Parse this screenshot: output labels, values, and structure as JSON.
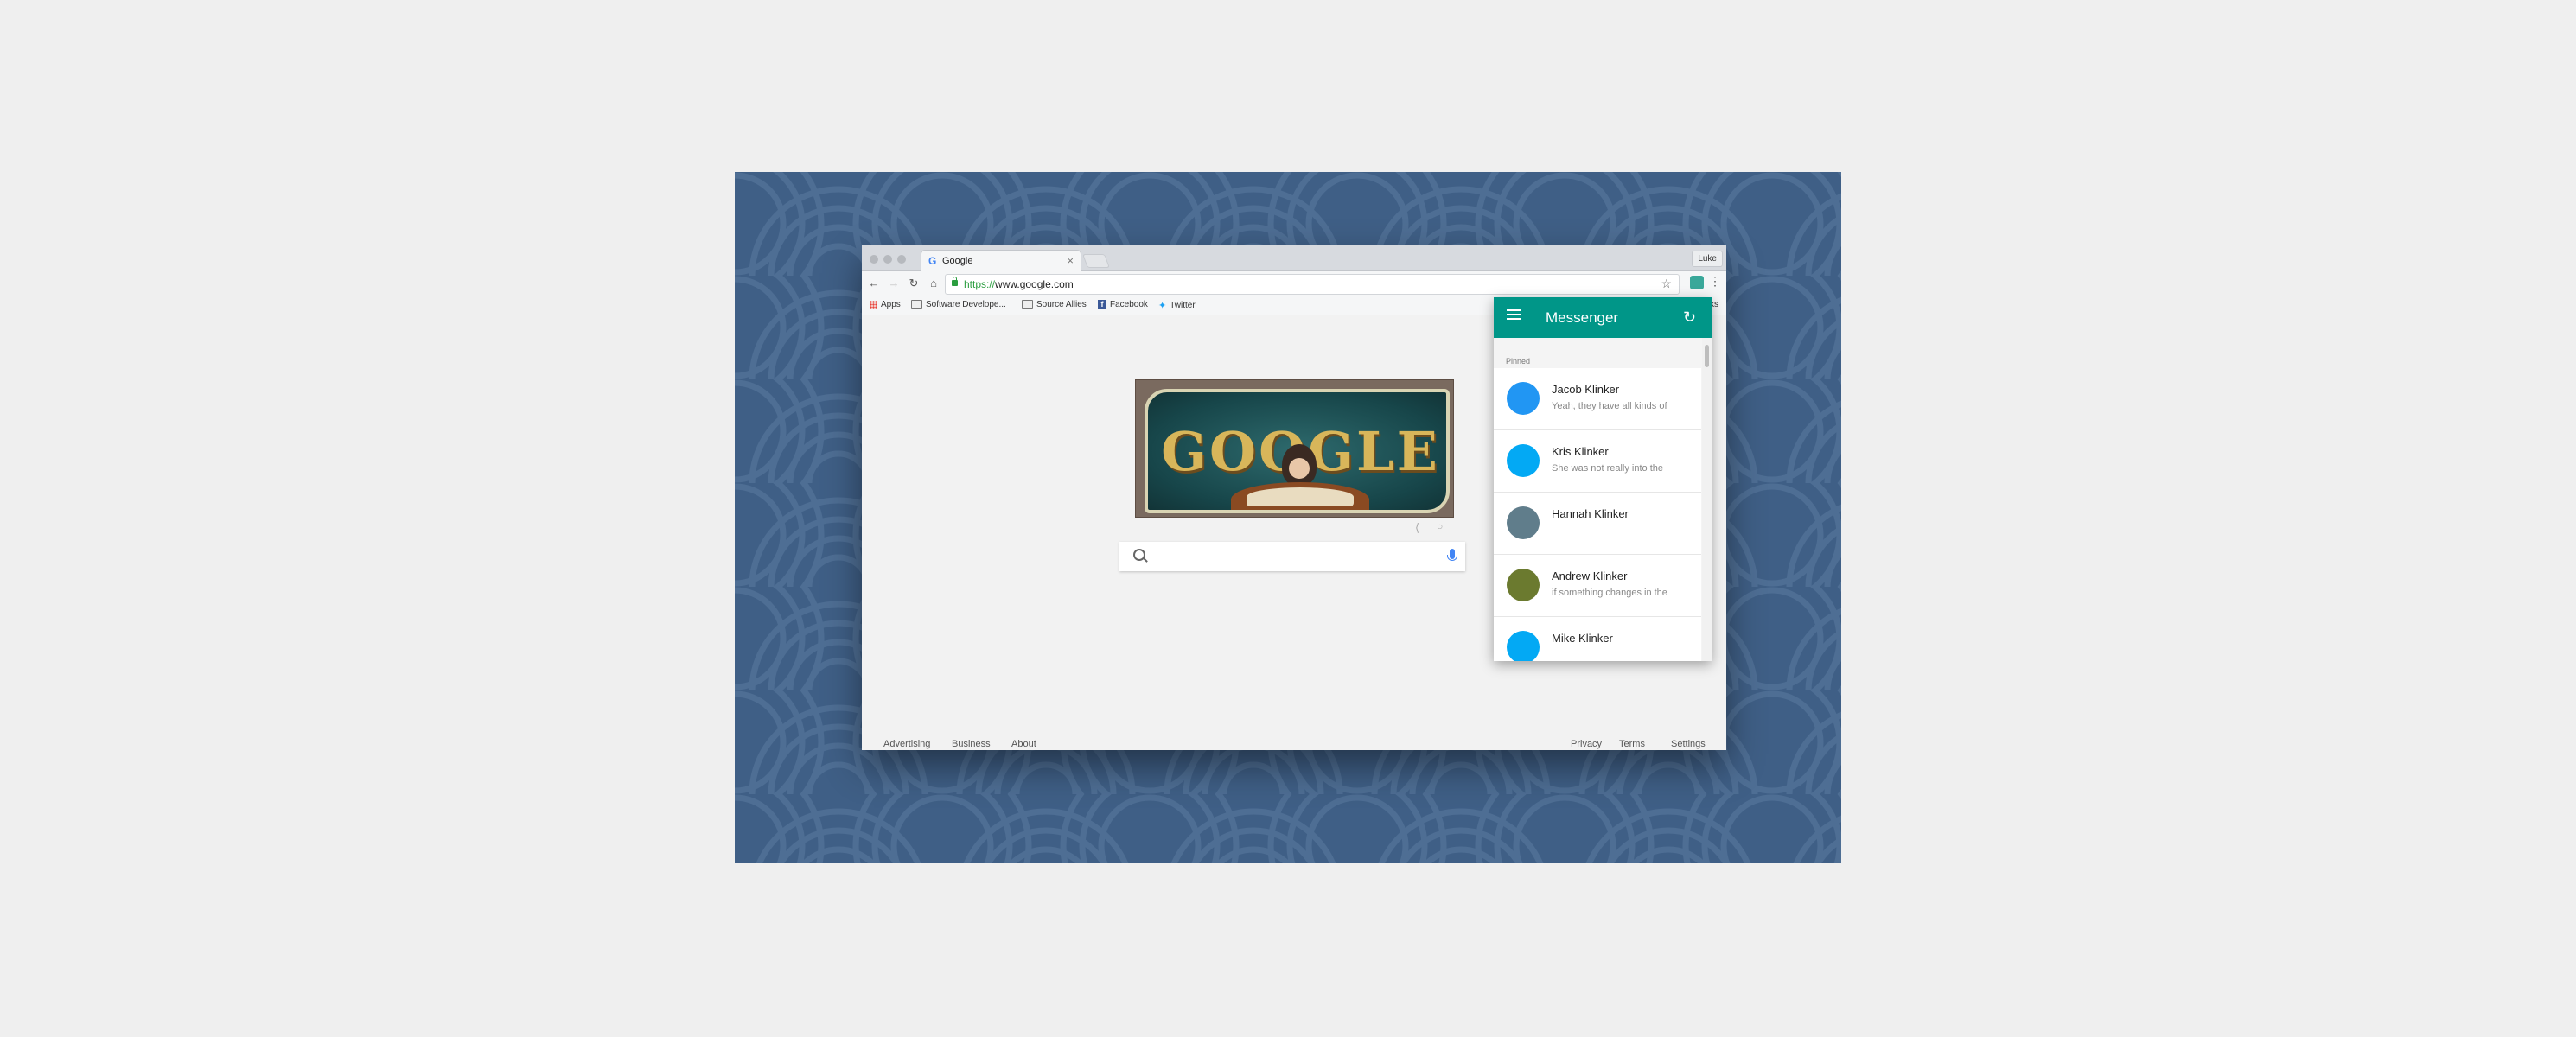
{
  "browser": {
    "tab": {
      "title": "Google"
    },
    "profile": "Luke",
    "url": {
      "scheme": "https://",
      "host": "www.google.com"
    },
    "bookmarks": [
      {
        "label": "Apps",
        "icon": "apps-icon"
      },
      {
        "label": "Software Develope...",
        "icon": "folder-icon"
      },
      {
        "label": "Source Allies",
        "icon": "folder-icon"
      },
      {
        "label": "Facebook",
        "icon": "facebook-icon"
      },
      {
        "label": "Twitter",
        "icon": "twitter-icon"
      }
    ],
    "bookmarks_overflow": "ks"
  },
  "page": {
    "doodle_text": "GOOGLE",
    "footer_left": [
      "Advertising",
      "Business",
      "About"
    ],
    "footer_right": [
      "Privacy",
      "Terms",
      "Settings"
    ]
  },
  "messenger": {
    "title": "Messenger",
    "accent_color": "#009688",
    "section_label": "Pinned",
    "conversations": [
      {
        "name": "Jacob Klinker",
        "preview": "Yeah, they have all kinds of",
        "color": "#2196f3"
      },
      {
        "name": "Kris Klinker",
        "preview": "She was not really into the",
        "color": "#03a9f4"
      },
      {
        "name": "Hannah Klinker",
        "preview": "",
        "color": "#607d8b"
      },
      {
        "name": "Andrew Klinker",
        "preview": "if something changes in the",
        "color": "#6b7a2f"
      },
      {
        "name": "Mike Klinker",
        "preview": "",
        "color": "#03a9f4"
      }
    ]
  }
}
